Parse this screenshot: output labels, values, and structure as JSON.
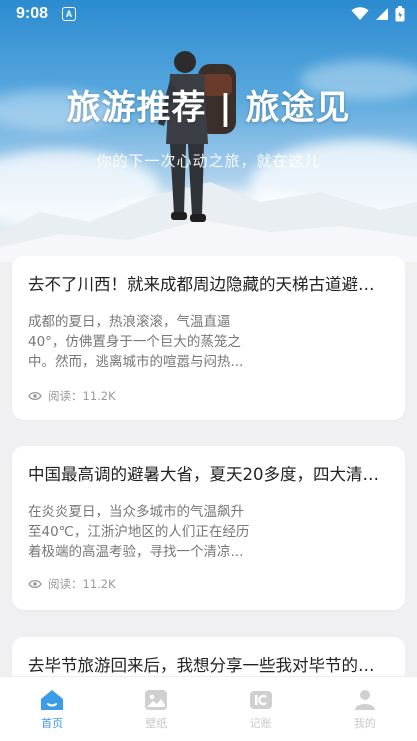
{
  "status_bar": {
    "time": "9:08",
    "notification_badge": "A"
  },
  "hero": {
    "title": "旅游推荐 | 旅途见",
    "subtitle": "你的下一次心动之旅，就在这儿"
  },
  "articles": [
    {
      "title": "去不了川西！就来成都周边隐藏的天梯古道避暑...",
      "excerpt": "成都的夏日，热浪滚滚，气温直逼40°，仿佛置身于一个巨大的蒸笼之中。然而，逃离城市的喧嚣与闷热...",
      "read_label": "阅读：11.2K"
    },
    {
      "title": "中国最高调的避暑大省，夏天20多度，四大清凉...",
      "excerpt": "在炎炎夏日，当众多城市的气温飙升至40℃，江浙沪地区的人们正在经历着极端的高温考验，寻找一个清凉...",
      "read_label": "阅读：11.2K"
    },
    {
      "title": "去毕节旅游回来后，我想分享一些我对毕节的看法"
    }
  ],
  "bottom_nav": {
    "items": [
      {
        "label": "首页",
        "icon": "home-icon",
        "active": true
      },
      {
        "label": "壁纸",
        "icon": "image-icon",
        "active": false
      },
      {
        "label": "记账",
        "icon": "ledger-icon",
        "active": false
      },
      {
        "label": "我的",
        "icon": "person-icon",
        "active": false
      }
    ]
  },
  "colors": {
    "accent": "#3d9be9",
    "inactive": "#c9c9c9",
    "background": "#f0f0f3"
  }
}
